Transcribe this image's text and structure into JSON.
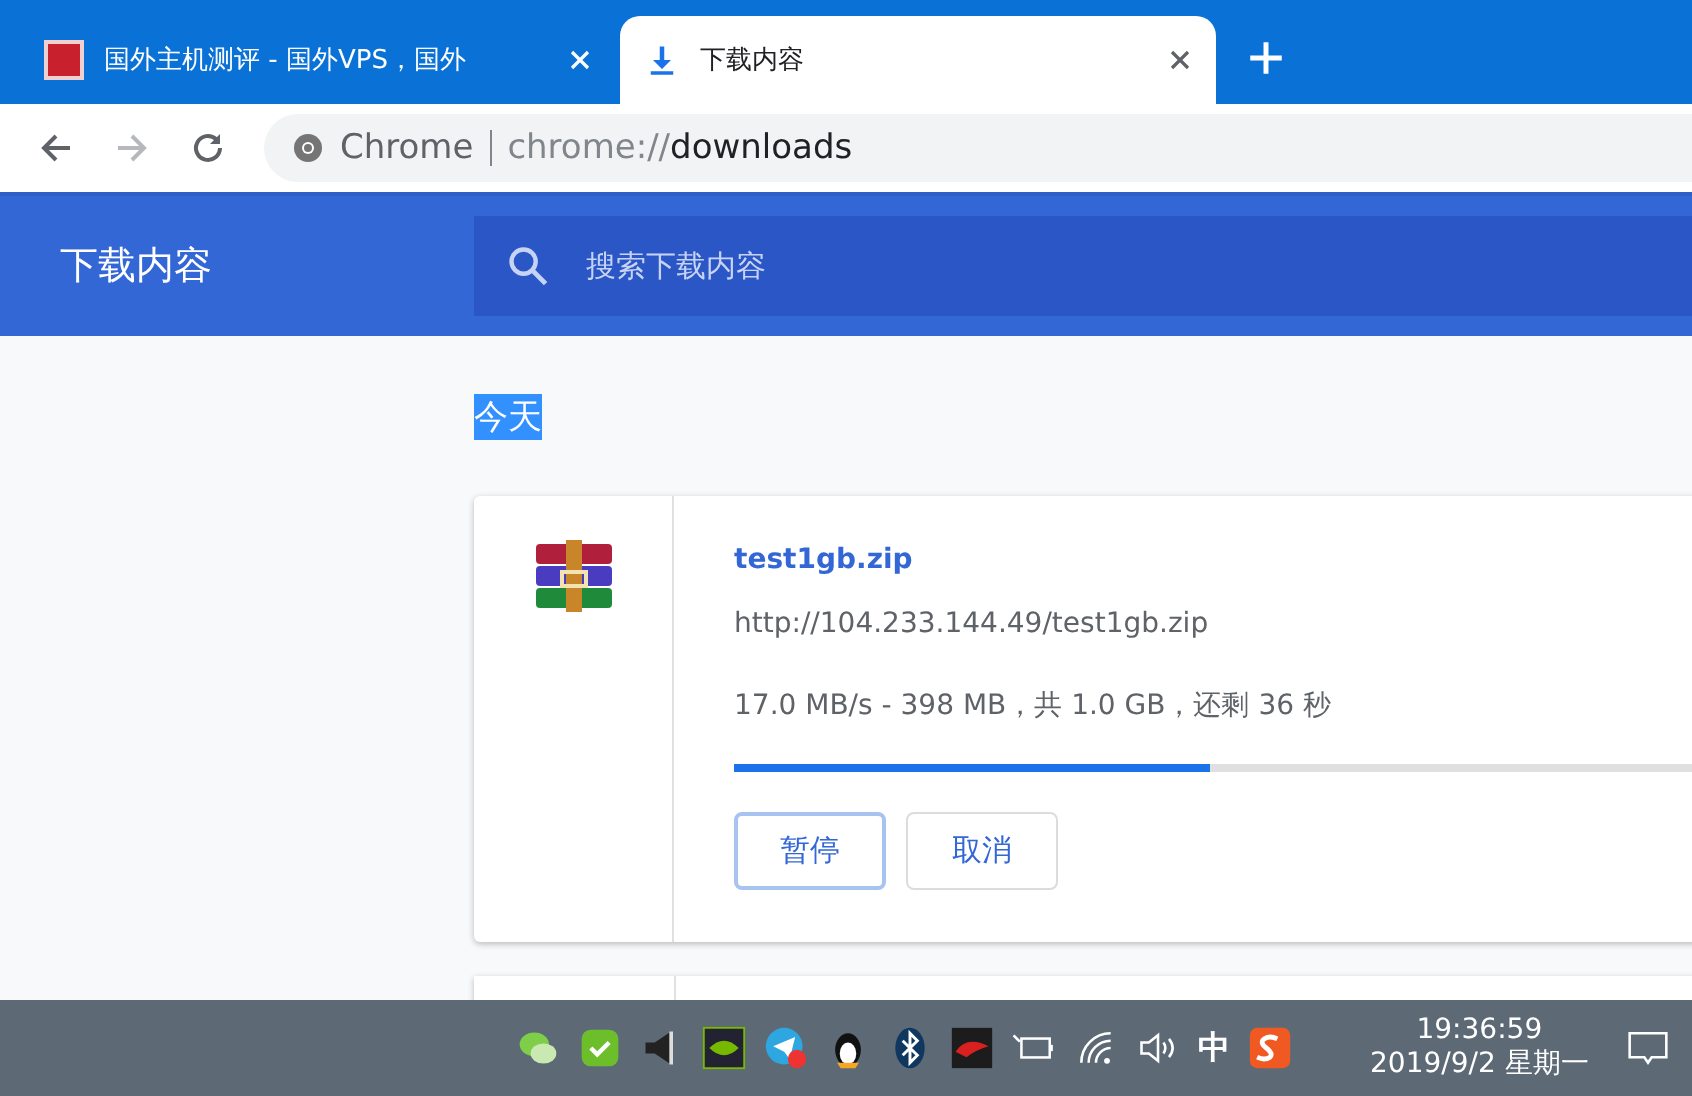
{
  "tabs": [
    {
      "title": "国外主机测评 - 国外VPS，国外",
      "kind": "site",
      "selected": false
    },
    {
      "title": "下载内容",
      "kind": "download",
      "selected": true
    }
  ],
  "address": {
    "site": "Chrome",
    "scheme": "chrome://",
    "path": "downloads"
  },
  "header": {
    "title": "下载内容",
    "search_placeholder": "搜索下载内容"
  },
  "section": {
    "label": "今天",
    "selected": true
  },
  "downloads": [
    {
      "name": "test1gb.zip",
      "url": "http://104.233.144.49/test1gb.zip",
      "status": "17.0 MB/s - 398 MB，共 1.0 GB，还剩 36 秒",
      "level": 0.4,
      "buttons": [
        {
          "label": "暂停",
          "focused": true
        },
        {
          "label": "取消",
          "focused": false
        }
      ]
    }
  ],
  "taskbar": {
    "ime": "中",
    "time": "19:36:59",
    "date": "2019/9/2 星期一"
  }
}
